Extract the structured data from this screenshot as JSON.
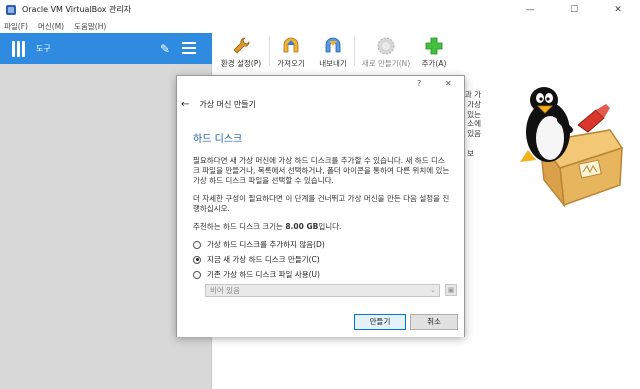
{
  "window": {
    "title": "Oracle VM VirtualBox 관리자",
    "minimize": "—",
    "maximize": "☐",
    "close": "✕"
  },
  "menubar": [
    "파일(F)",
    "머신(M)",
    "도움말(H)"
  ],
  "sidebar": {
    "tools_label": "도구",
    "pin_icon": "pin-icon",
    "menu_icon": "list-icon"
  },
  "toolbar": {
    "buttons": [
      {
        "label": "환경 설정(P)",
        "icon": "wrench-icon",
        "color": "#d98a1c"
      },
      {
        "label": "가져오기",
        "icon": "import-icon",
        "color": "#e0a21e"
      },
      {
        "label": "내보내기",
        "icon": "export-icon",
        "color": "#3a7fd0"
      },
      {
        "label": "새로 만들기(N)",
        "icon": "new-gear-icon",
        "color": "#bdbdbd"
      },
      {
        "label": "추가(A)",
        "icon": "plus-icon",
        "color": "#3cb43c"
      }
    ]
  },
  "welcome": {
    "text": "에 오신 것을 환영합니다!\n\n이 창의 왼쪽 부분에는 컴퓨터에 있는 전역 도구와 가\n상 머신 및 가상 머신 그룹 목록이 있습니다. 가\n져오기, 추가, 새로 만들기를 사용하여 새 가상\n머신을 만들 수 있습니다. 자세한 정보는 있음",
    "line2": "을 눌러서 최신 정보와 새 소식을 보"
  },
  "dialog": {
    "help_label": "?",
    "close_label": "✕",
    "back_label": "←",
    "header_title": "가상 머신 만들기",
    "section_title": "하드 디스크",
    "para1": "필요하다면 새 가상 머신에 가상 하드 디스크를 추가할 수 있습니다. 새 하드 디스크 파일을 만들거나, 목록에서 선택하거나, 폴더 아이콘을 통하여 다른 위치에 있는 가상 하드 디스크 파일을 선택할 수 있습니다.",
    "para2": "더 자세한 구성이 필요하다면 이 단계를 건너뛰고 가상 머신을 만든 다음 설정을 진행하십시오.",
    "recommended_prefix": "추천하는 하드 디스크 크기는 ",
    "recommended_size": "8.00 GB",
    "recommended_suffix": "입니다.",
    "options": [
      {
        "label": "가상 하드 디스크를 추가하지 않음(D)",
        "selected": false
      },
      {
        "label": "지금 새 가상 하드 디스크 만들기(C)",
        "selected": true
      },
      {
        "label": "기존 가상 하드 디스크 파일 사용(U)",
        "selected": false
      }
    ],
    "disk_select_value": "비어 있음",
    "create_button": "만들기",
    "cancel_button": "취소"
  }
}
